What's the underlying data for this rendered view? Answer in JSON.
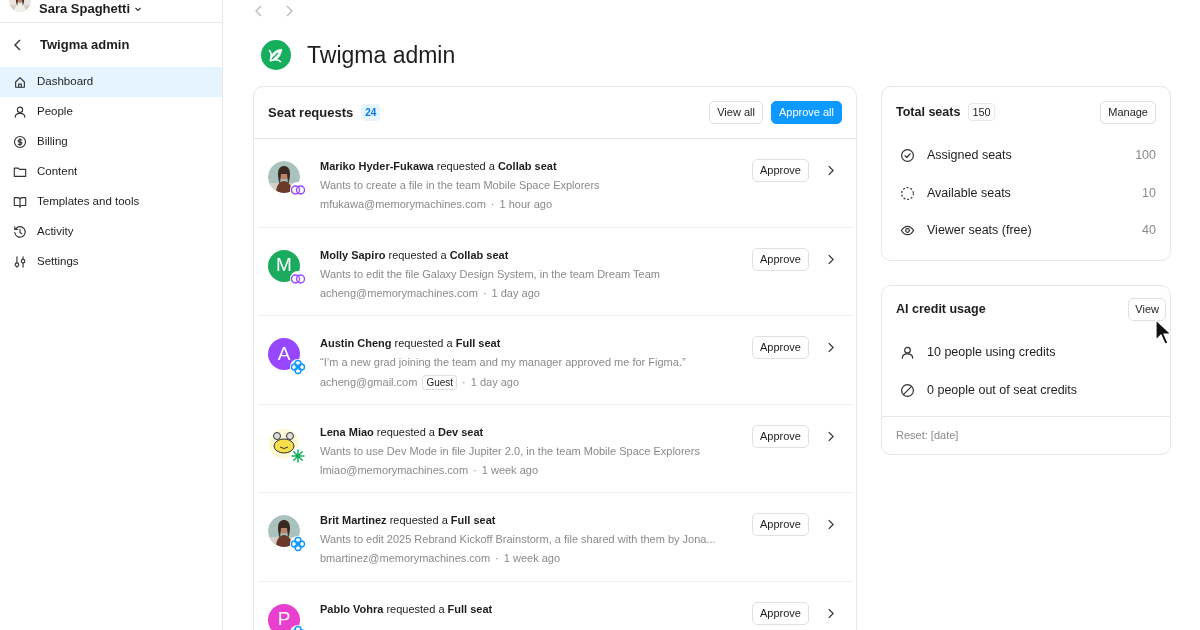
{
  "user_menu": {
    "name": "Sara Spaghetti"
  },
  "sidebar": {
    "back_title": "Twigma admin",
    "items": [
      {
        "label": "Dashboard",
        "kind": "home",
        "selected": true
      },
      {
        "label": "People",
        "kind": "person",
        "selected": false
      },
      {
        "label": "Billing",
        "kind": "billing",
        "selected": false
      },
      {
        "label": "Content",
        "kind": "folder",
        "selected": false
      },
      {
        "label": "Templates and tools",
        "kind": "book",
        "selected": false
      },
      {
        "label": "Activity",
        "kind": "history",
        "selected": false
      },
      {
        "label": "Settings",
        "kind": "sliders",
        "selected": false
      }
    ]
  },
  "page": {
    "title": "Twigma admin"
  },
  "seat_requests": {
    "title": "Seat requests",
    "count": "24",
    "buttons": [
      {
        "label": "View all",
        "kind": "secondary"
      },
      {
        "label": "Approve all",
        "kind": "primary"
      }
    ],
    "rows": [
      {
        "kind": "collab",
        "heading": "**Mariko Hyder-Fukawa** requested a **Collab seat**",
        "detail": "Wants to create a file in the team Mobile Space Explorers",
        "email": "mfukawa@memorymachines.com",
        "separator": "·",
        "time": "1 hour ago",
        "action": "Approve"
      },
      {
        "avatar": {
          "kind": "letter",
          "letter": "M",
          "color": "#1bab5f"
        },
        "kind": "collab",
        "heading": "**Molly Sapiro** requested a **Collab seat**",
        "detail": "Wants to edit the file Galaxy Design System, in the team Dream Team",
        "email": "acheng@memorymachines.com",
        "separator": "·",
        "time": "1 day ago",
        "action": "Approve"
      },
      {
        "avatar": {
          "kind": "letter",
          "letter": "A",
          "color": "#9747ff"
        },
        "kind": "full",
        "heading": "**Austin Cheng** requested a **Full seat**",
        "detail": "“I’m a new grad joining the team and my manager approved me for Figma.”",
        "email": "acheng@gmail.com",
        "tag": "Guest",
        "separator": "·",
        "time": "1 day ago",
        "action": "Approve"
      },
      {
        "avatar": {
          "kind": "illustration"
        },
        "kind": "dev",
        "heading": "**Lena Miao** requested a **Dev seat**",
        "detail": "Wants to use Dev Mode in file Jupiter 2.0, in the team Mobile Space Explorers",
        "email": "lmiao@memorymachines.com",
        "separator": "·",
        "time": "1 week ago",
        "action": "Approve"
      },
      {
        "kind": "full",
        "heading": "**Brit Martinez** requested a **Full seat**",
        "detail": "Wants to edit 2025 Rebrand Kickoff Brainstorm, a file shared with them by Jona...",
        "email": "bmartinez@memorymachines.com",
        "separator": "·",
        "time": "1 week ago",
        "action": "Approve"
      },
      {
        "avatar": {
          "kind": "letter",
          "letter": "P",
          "color": "#e83fd0"
        },
        "kind": "full",
        "heading": "**Pablo Vohra** requested a **Full seat**",
        "action": "Approve"
      }
    ]
  },
  "total_seats": {
    "title": "Total seats",
    "count": "150",
    "button": "Manage",
    "rows": [
      {
        "kind": "check",
        "label": "Assigned seats",
        "value": "100"
      },
      {
        "kind": "dashed",
        "label": "Available seats",
        "value": "10"
      },
      {
        "kind": "eye",
        "label": "Viewer seats (free)",
        "value": "40"
      }
    ]
  },
  "ai_credit": {
    "title": "AI credit usage",
    "button": "View",
    "rows": [
      {
        "kind": "person",
        "label": "10 people using credits"
      },
      {
        "kind": "blocked",
        "label": "0 people out of seat credits"
      }
    ],
    "footer": "Reset: [date]"
  }
}
